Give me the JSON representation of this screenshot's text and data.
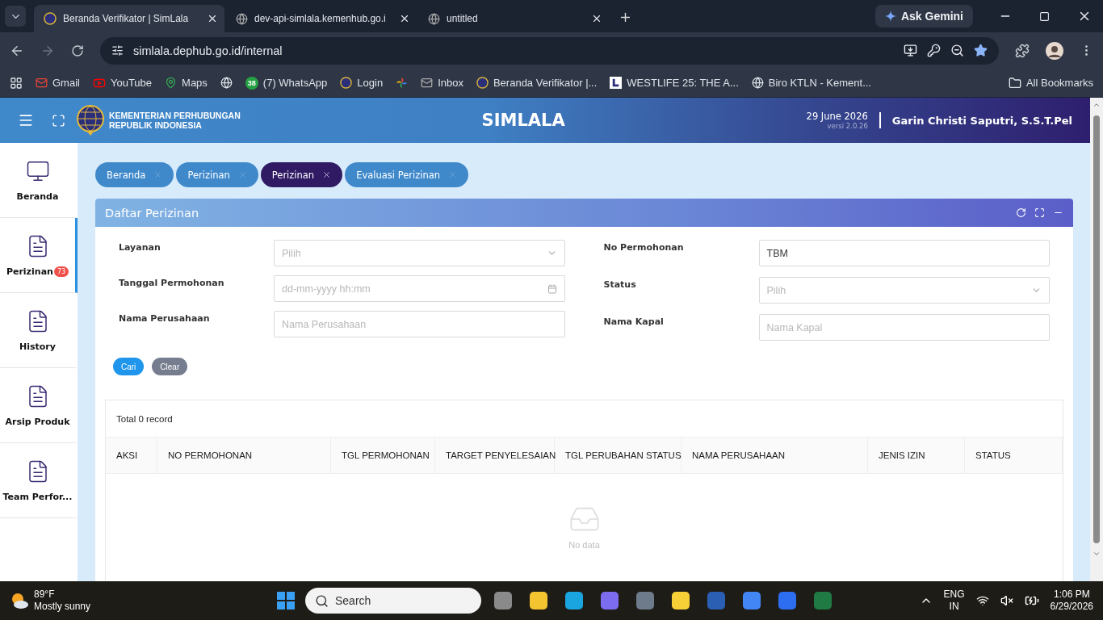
{
  "browser": {
    "tabs": [
      {
        "title": "Beranda Verifikator | SimLala",
        "selected": true
      },
      {
        "title": "dev-api-simlala.kemenhub.go.i",
        "selected": false
      },
      {
        "title": "untitled",
        "selected": false
      }
    ],
    "ask_gemini": "Ask Gemini",
    "url": "simlala.dephub.go.id/internal",
    "bookmarks": [
      {
        "label": "Gmail",
        "kind": "gmail"
      },
      {
        "label": "YouTube",
        "kind": "youtube"
      },
      {
        "label": "Maps",
        "kind": "maps"
      },
      {
        "kind": "globe"
      },
      {
        "label": "(7) WhatsApp",
        "kind": "whatsapp",
        "badge": "38"
      },
      {
        "label": "Login",
        "kind": "logo"
      },
      {
        "kind": "photos"
      },
      {
        "label": "Inbox",
        "kind": "mail"
      },
      {
        "label": "Beranda Verifikator |...",
        "kind": "logo"
      },
      {
        "label": "WESTLIFE 25: THE A...",
        "kind": "square"
      },
      {
        "label": "Biro KTLN - Kement...",
        "kind": "globe"
      }
    ],
    "all_bookmarks": "All Bookmarks"
  },
  "header": {
    "org": [
      "KEMENTERIAN PERHUBUNGAN",
      "REPUBLIK INDONESIA"
    ],
    "title": "SIMLALA",
    "date": "29 June 2026",
    "version": "versi 2.0.26",
    "user": "Garin Christi Saputri, S.S.T.Pel"
  },
  "sidebar": {
    "items": [
      {
        "label": "Beranda",
        "kind": "monitor",
        "selected": false
      },
      {
        "label": "Perizinan",
        "kind": "file",
        "selected": true,
        "badge": "73"
      },
      {
        "label": "History",
        "kind": "file",
        "selected": false
      },
      {
        "label": "Arsip Produk",
        "kind": "file",
        "selected": false
      },
      {
        "label": "Team Perfor...",
        "kind": "file",
        "selected": false
      }
    ]
  },
  "breadcrumbs": [
    {
      "label": "Beranda",
      "selected": false
    },
    {
      "label": "Perizinan",
      "selected": false
    },
    {
      "label": "Perizinan",
      "selected": true
    },
    {
      "label": "Evaluasi Perizinan",
      "selected": false
    }
  ],
  "panel": {
    "title": "Daftar Perizinan",
    "left_fields": [
      {
        "label": "Layanan",
        "kind": "select",
        "placeholder": "Pilih"
      },
      {
        "label": "Tanggal Permohonan",
        "kind": "date",
        "placeholder": "dd-mm-yyyy hh:mm"
      },
      {
        "label": "Nama Perusahaan",
        "kind": "text",
        "placeholder": "Nama Perusahaan"
      }
    ],
    "right_fields": [
      {
        "label": "No Permohonan",
        "kind": "text",
        "value": "TBM"
      },
      {
        "label": "Status",
        "kind": "select",
        "placeholder": "Pilih"
      },
      {
        "label": "Nama Kapal",
        "kind": "text",
        "placeholder": "Nama Kapal"
      }
    ],
    "buttons": [
      {
        "label": "Cari",
        "kind": "primary"
      },
      {
        "label": "Clear",
        "kind": "secondary"
      }
    ],
    "total": "Total 0 record",
    "table": {
      "columns": [
        "AKSI",
        "NO PERMOHONAN",
        "TGL PERMOHONAN",
        "TARGET PENYELESAIAN",
        "TGL PERUBAHAN STATUS",
        "NAMA PERUSAHAAN",
        "JENIS IZIN",
        "STATUS"
      ],
      "empty": "No data"
    }
  },
  "taskbar": {
    "temperature": "89°F",
    "weather": "Mostly sunny",
    "search_placeholder": "Search",
    "language": "ENG",
    "region": "IN",
    "time": "1:06 PM",
    "date": "6/29/2026"
  }
}
